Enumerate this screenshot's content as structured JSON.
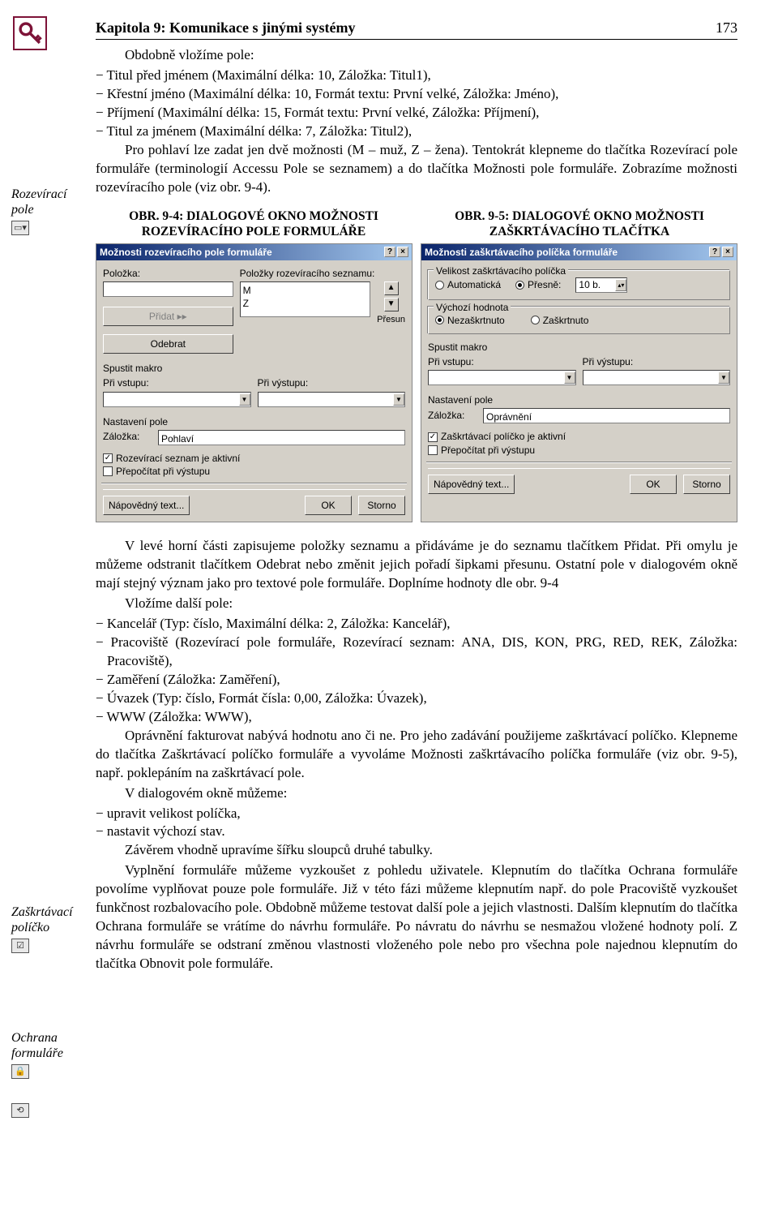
{
  "header": {
    "chapter_title": "Kapitola 9: Komunikace s jinými systémy",
    "page_number": "173"
  },
  "margin": {
    "note1": "Rozevírací pole",
    "note2": "Zaškrtávací políčko",
    "note3": "Ochrana formuláře"
  },
  "text": {
    "p1_lead": "Obdobně vložíme pole:",
    "b1": "Titul před jménem (Maximální délka: 10, Záložka: Titul1),",
    "b2": "Křestní jméno (Maximální délka: 10, Formát textu: První velké, Záložka: Jméno),",
    "b3": "Příjmení (Maximální délka: 15, Formát textu: První velké, Záložka: Příjmení),",
    "b4": "Titul za jménem (Maximální délka: 7, Záložka: Titul2),",
    "p2": "Pro pohlaví lze zadat jen dvě možnosti (M – muž, Z – žena). Tentokrát klepneme do tlačítka Rozevírací pole formuláře (terminologií Accessu Pole se seznamem) a do tlačítka Možnosti pole formuláře. Zobrazíme možnosti rozevíracího pole (viz obr. 9-4).",
    "fig94_cap": "OBR. 9-4: DIALOGOVÉ OKNO MOŽNOSTI ROZEVÍRACÍHO POLE FORMULÁŘE",
    "fig95_cap": "OBR. 9-5: DIALOGOVÉ OKNO MOŽNOSTI ZAŠKRTÁVACÍHO TLAČÍTKA",
    "p3": "V levé horní části zapisujeme položky seznamu a přidáváme je do seznamu tlačítkem Přidat. Při omylu je můžeme odstranit tlačítkem Odebrat nebo změnit jejich pořadí šipkami přesunu. Ostatní pole v dialogovém okně mají stejný význam jako pro textové pole formuláře. Doplníme hodnoty dle obr. 9-4",
    "p4_lead": "Vložíme další pole:",
    "b5": "Kancelář (Typ: číslo, Maximální délka: 2, Záložka: Kancelář),",
    "b6": "Pracoviště (Rozevírací pole formuláře, Rozevírací seznam: ANA, DIS, KON, PRG, RED, REK, Záložka: Pracoviště),",
    "b7": "Zaměření (Záložka: Zaměření),",
    "b8": "Úvazek (Typ: číslo, Formát čísla: 0,00, Záložka: Úvazek),",
    "b9": "WWW (Záložka: WWW),",
    "p5": "Oprávnění fakturovat nabývá hodnotu ano či ne. Pro jeho zadávání použijeme zaškrtávací políčko. Klepneme do tlačítka Zaškrtávací políčko formuláře a vyvoláme Možnosti zaškrtávacího políčka formuláře (viz obr. 9-5), např. poklepáním na zaškrtávací pole.",
    "p6_lead": "V dialogovém okně můžeme:",
    "b10": "upravit velikost políčka,",
    "b11": "nastavit výchozí stav.",
    "p7": "Závěrem vhodně upravíme šířku sloupců druhé tabulky.",
    "p8": "Vyplnění formuláře můžeme vyzkoušet z pohledu uživatele. Klepnutím do tlačítka Ochrana formuláře povolíme vyplňovat pouze pole formuláře. Již v této fázi můžeme klepnutím např. do pole Pracoviště vyzkoušet funkčnost rozbalovacího pole. Obdobně můžeme testovat další pole a jejich vlastnosti. Dalším klepnutím do tlačítka Ochrana formuláře se vrátíme do návrhu formuláře. Po návratu do návrhu se nesmažou vložené hodnoty polí. Z návrhu formuláře se odstraní změnou vlastnosti vloženého pole nebo pro všechna pole najednou klepnutím do tlačítka Obnovit pole formuláře."
  },
  "dlg94": {
    "title": "Možnosti rozevíracího pole formuláře",
    "lbl_polozka": "Položka:",
    "lbl_polozky": "Položky rozevíracího seznamu:",
    "item1": "M",
    "item2": "Z",
    "btn_pridat": "Přidat ▸▸",
    "btn_odebrat": "Odebrat",
    "lbl_presun": "Přesun",
    "lbl_spustit": "Spustit makro",
    "lbl_privstupu": "Při vstupu:",
    "lbl_privystupu": "Při výstupu:",
    "lbl_nastaveni": "Nastavení pole",
    "lbl_zalozka": "Záložka:",
    "val_zalozka": "Pohlaví",
    "chk_aktivni": "Rozevírací seznam je aktivní",
    "chk_prepocitat": "Přepočítat při výstupu",
    "btn_napoveda": "Nápovědný text...",
    "btn_ok": "OK",
    "btn_storno": "Storno"
  },
  "dlg95": {
    "title": "Možnosti zaškrtávacího políčka formuláře",
    "grp_velikost": "Velikost zaškrtávacího políčka",
    "radio_auto": "Automatická",
    "radio_presne": "Přesně:",
    "val_presne": "10 b.",
    "grp_vychozi": "Výchozí hodnota",
    "radio_nezask": "Nezaškrtnuto",
    "radio_zask": "Zaškrtnuto",
    "lbl_spustit": "Spustit makro",
    "lbl_privstupu": "Při vstupu:",
    "lbl_privystupu": "Při výstupu:",
    "lbl_nastaveni": "Nastavení pole",
    "lbl_zalozka": "Záložka:",
    "val_zalozka": "Oprávnění",
    "chk_aktivni": "Zaškrtávací políčko je aktivní",
    "chk_prepocitat": "Přepočítat při výstupu",
    "btn_napoveda": "Nápovědný text...",
    "btn_ok": "OK",
    "btn_storno": "Storno"
  }
}
